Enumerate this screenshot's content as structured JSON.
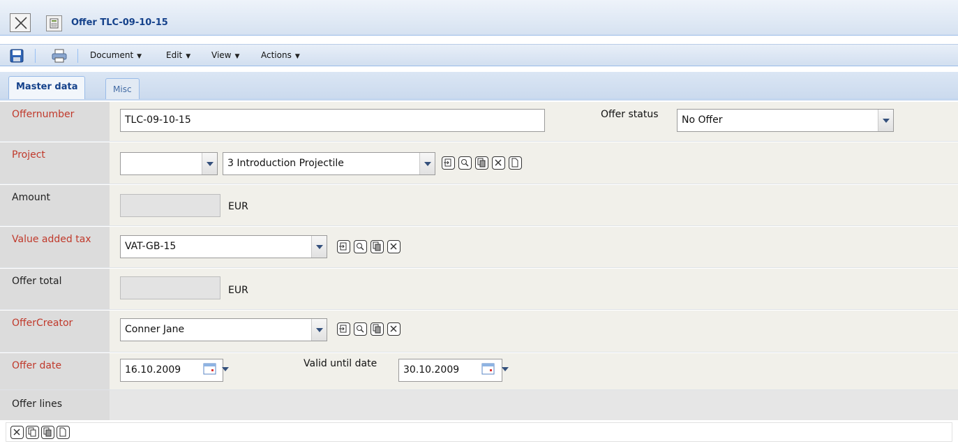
{
  "window": {
    "title": "Offer TLC-09-10-15"
  },
  "toolbar": {
    "menus": [
      {
        "label": "Document"
      },
      {
        "label": "Edit"
      },
      {
        "label": "View"
      },
      {
        "label": "Actions"
      }
    ]
  },
  "tabs": [
    {
      "label": "Master data",
      "active": true
    },
    {
      "label": "Misc",
      "active": false
    }
  ],
  "form": {
    "offernumber": {
      "label": "Offernumber",
      "value": "TLC-09-10-15"
    },
    "offer_status": {
      "label": "Offer status",
      "value": "No Offer"
    },
    "project": {
      "label": "Project",
      "value_left": "",
      "value": "3 Introduction Projectile"
    },
    "amount": {
      "label": "Amount",
      "value": "",
      "unit": "EUR"
    },
    "vat": {
      "label": "Value added tax",
      "value": "VAT-GB-15"
    },
    "offer_total": {
      "label": "Offer total",
      "value": "",
      "unit": "EUR"
    },
    "offer_creator": {
      "label": "OfferCreator",
      "value": "Conner Jane"
    },
    "offer_date": {
      "label": "Offer date",
      "value": "16.10.2009"
    },
    "valid_until": {
      "label": "Valid until date",
      "value": "30.10.2009"
    }
  },
  "offer_lines": {
    "label": "Offer lines"
  },
  "colors": {
    "required_label": "#c0392b",
    "header_text": "#15428b"
  },
  "icons": [
    "close-icon",
    "document-icon",
    "save-icon",
    "print-icon",
    "jump-icon",
    "search-icon",
    "copy-icon",
    "clear-icon",
    "new-icon",
    "calendar-icon"
  ]
}
